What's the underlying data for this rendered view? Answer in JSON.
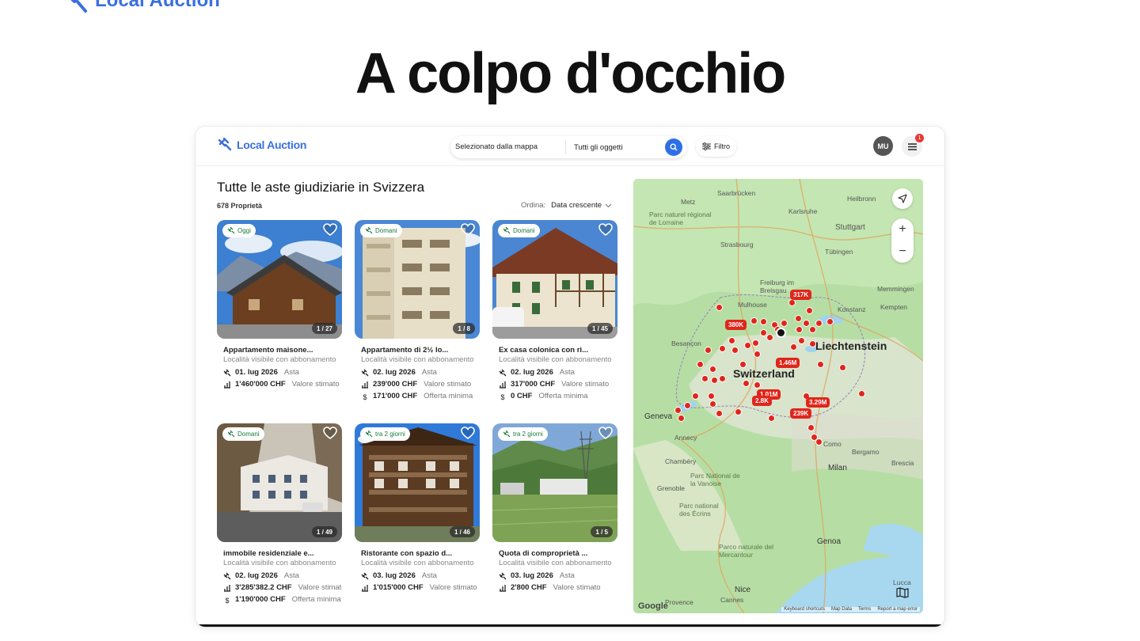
{
  "brand_top": "Local Auction",
  "hero_title": "A colpo d'occhio",
  "app": {
    "brand": "Local Auction",
    "search": {
      "scope": "Selezionato dalla mappa",
      "objects": "Tutti gli oggetti"
    },
    "filter_label": "Filtro",
    "avatar": "MU",
    "notifications": "1"
  },
  "list": {
    "title": "Tutte le aste giudiziarie in Svizzera",
    "count": "678 Proprietà",
    "sort_label": "Ordina:",
    "sort_value": "Data crescente"
  },
  "cards": [
    {
      "badge": "Oggi",
      "counter": "1 / 27",
      "title": "Appartamento maisone...",
      "location": "Località visibile con abbonamento",
      "date": "01. lug 2026",
      "date_type": "Asta",
      "value": "1'460'000 CHF",
      "value_label": "Valore stimato"
    },
    {
      "badge": "Domani",
      "counter": "1 / 8",
      "title": "Appartamento di 2½ lo...",
      "location": "Località visibile con abbonamento",
      "date": "02. lug 2026",
      "date_type": "Asta",
      "value": "239'000 CHF",
      "value_label": "Valore stimato",
      "min": "171'000 CHF",
      "min_label": "Offerta minima"
    },
    {
      "badge": "Domani",
      "counter": "1 / 45",
      "title": "Ex casa colonica con ri...",
      "location": "Località visibile con abbonamento",
      "date": "02. lug 2026",
      "date_type": "Asta",
      "value": "317'000 CHF",
      "value_label": "Valore stimato",
      "min": "0 CHF",
      "min_label": "Offerta minima"
    },
    {
      "badge": "Domani",
      "counter": "1 / 49",
      "title": "immobile residenziale e...",
      "location": "Località visibile con abbonamento",
      "date": "02. lug 2026",
      "date_type": "Asta",
      "value": "3'285'382.2 CHF",
      "value_label": "Valore stimato",
      "min": "1'190'000 CHF",
      "min_label": "Offerta minima"
    },
    {
      "badge": "tra 2 giorni",
      "counter": "1 / 46",
      "title": "Ristorante con spazio d...",
      "location": "Località visibile con abbonamento",
      "date": "03. lug 2026",
      "date_type": "Asta",
      "value": "1'015'000 CHF",
      "value_label": "Valore stimato"
    },
    {
      "badge": "tra 2 giorni",
      "counter": "1 / 5",
      "title": "Quota di comproprietà ...",
      "location": "Località visibile con abbonamento",
      "date": "03. lug 2026",
      "date_type": "Asta",
      "value": "2'800 CHF",
      "value_label": "Valore stimato"
    }
  ],
  "map": {
    "labels": [
      "Metz",
      "Saarbrücken",
      "Heilbronn",
      "Karlsruhe",
      "Stuttgart",
      "Strasbourg",
      "Tübingen",
      "Freiburg im Breisgau",
      "Mulhouse",
      "Konstanz",
      "Kempten",
      "Memmingen",
      "Besançon",
      "Switzerland",
      "Liechtenstein",
      "Geneva",
      "Annecy",
      "Como",
      "Bergamo",
      "Brescia",
      "Milan",
      "Chambéry",
      "Grenoble",
      "Genoa",
      "Nice",
      "Cannes",
      "Lucca",
      "Parc naturel régional de Lorraine",
      "Parc National de la Vanoise",
      "Parc national des Écrins",
      "Parco naturale del Mercantour",
      "Provence"
    ],
    "prices": [
      "317K",
      "380K",
      "1.46M",
      "1.01M",
      "2.8K",
      "3.29M",
      "239K"
    ],
    "attribution": [
      "Keyboard shortcuts",
      "Map Data",
      "Terms",
      "Report a map error"
    ],
    "google": "Google"
  },
  "icons": [
    "gavel-icon",
    "search-icon",
    "sliders-icon",
    "menu-icon",
    "heart-icon",
    "gavel-small-icon",
    "chart-icon",
    "dollar-icon",
    "navigate-icon",
    "map-layers-icon"
  ]
}
